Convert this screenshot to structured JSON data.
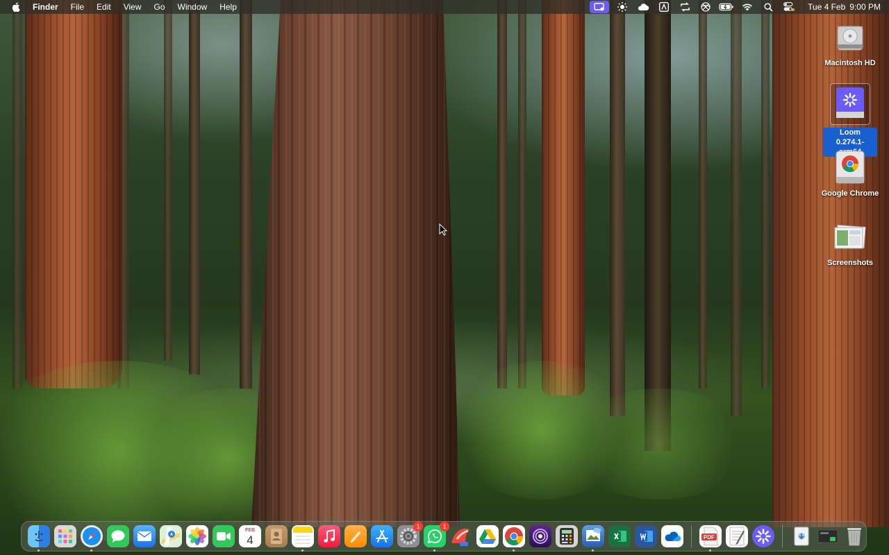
{
  "menubar": {
    "apple_icon": "apple-icon",
    "app_name": "Finder",
    "menus": [
      "File",
      "Edit",
      "View",
      "Go",
      "Window",
      "Help"
    ],
    "status_icons": [
      "screen-record-icon",
      "brightness-icon",
      "cloud-icon",
      "a-box-icon",
      "sync-icon",
      "vpn-icon",
      "battery-icon",
      "wifi-icon",
      "search-icon",
      "control-center-icon"
    ],
    "date": "Tue 4 Feb",
    "time": "9:00 PM",
    "accent_color": "#6e5cf0"
  },
  "desktop": {
    "items": [
      {
        "label": "Macintosh HD",
        "icon": "hard-drive-icon",
        "selected": false
      },
      {
        "label": "Loom 0.274.1-arm64",
        "icon": "disk-image-icon",
        "selected": true
      },
      {
        "label": "Google Chrome",
        "icon": "chrome-disk-icon",
        "selected": false
      },
      {
        "label": "Screenshots",
        "icon": "screenshots-folder-icon",
        "selected": false
      }
    ],
    "selection_color": "#1a5fcf"
  },
  "dock": {
    "apps": [
      {
        "name": "Finder",
        "icon": "finder-icon",
        "running": true
      },
      {
        "name": "Launchpad",
        "icon": "launchpad-icon",
        "running": false
      },
      {
        "name": "Safari",
        "icon": "safari-icon",
        "running": true
      },
      {
        "name": "Messages",
        "icon": "messages-icon",
        "running": false
      },
      {
        "name": "Mail",
        "icon": "mail-icon",
        "running": false
      },
      {
        "name": "Maps",
        "icon": "maps-icon",
        "running": false
      },
      {
        "name": "Photos",
        "icon": "photos-icon",
        "running": false
      },
      {
        "name": "FaceTime",
        "icon": "facetime-icon",
        "running": false
      },
      {
        "name": "Calendar",
        "icon": "calendar-icon",
        "running": false,
        "month": "FEB",
        "day": "4"
      },
      {
        "name": "Contacts",
        "icon": "contacts-icon",
        "running": false
      },
      {
        "name": "Notes",
        "icon": "notes-icon",
        "running": true
      },
      {
        "name": "Music",
        "icon": "music-icon",
        "running": false
      },
      {
        "name": "Pages",
        "icon": "pages-icon",
        "running": false
      },
      {
        "name": "App Store",
        "icon": "app-store-icon",
        "running": false
      },
      {
        "name": "System Settings",
        "icon": "settings-icon",
        "running": false,
        "badge": "1"
      },
      {
        "name": "WhatsApp",
        "icon": "whatsapp-icon",
        "running": true,
        "badge": "1"
      },
      {
        "name": "CleanMyMac",
        "icon": "cleanmymac-icon",
        "running": false
      },
      {
        "name": "Google Drive",
        "icon": "google-drive-icon",
        "running": false
      },
      {
        "name": "Google Chrome",
        "icon": "chrome-icon",
        "running": true
      },
      {
        "name": "Tor",
        "icon": "tor-icon",
        "running": false
      },
      {
        "name": "Calculator",
        "icon": "calculator-icon",
        "running": false
      },
      {
        "name": "Preview",
        "icon": "preview-icon",
        "running": true
      },
      {
        "name": "Excel",
        "icon": "excel-icon",
        "running": false
      },
      {
        "name": "Word",
        "icon": "word-icon",
        "running": false
      },
      {
        "name": "OneDrive",
        "icon": "onedrive-icon",
        "running": false
      },
      {
        "name": "PDF Expert",
        "icon": "pdf-icon",
        "running": true
      },
      {
        "name": "TextEdit",
        "icon": "textedit-icon",
        "running": false
      },
      {
        "name": "Loom",
        "icon": "loom-icon",
        "running": false
      },
      {
        "name": "Downloads",
        "icon": "downloads-stack-icon",
        "running": false
      },
      {
        "name": "Screen Capture",
        "icon": "screen-capture-icon",
        "running": false
      },
      {
        "name": "Trash",
        "icon": "trash-icon",
        "running": false
      }
    ]
  }
}
